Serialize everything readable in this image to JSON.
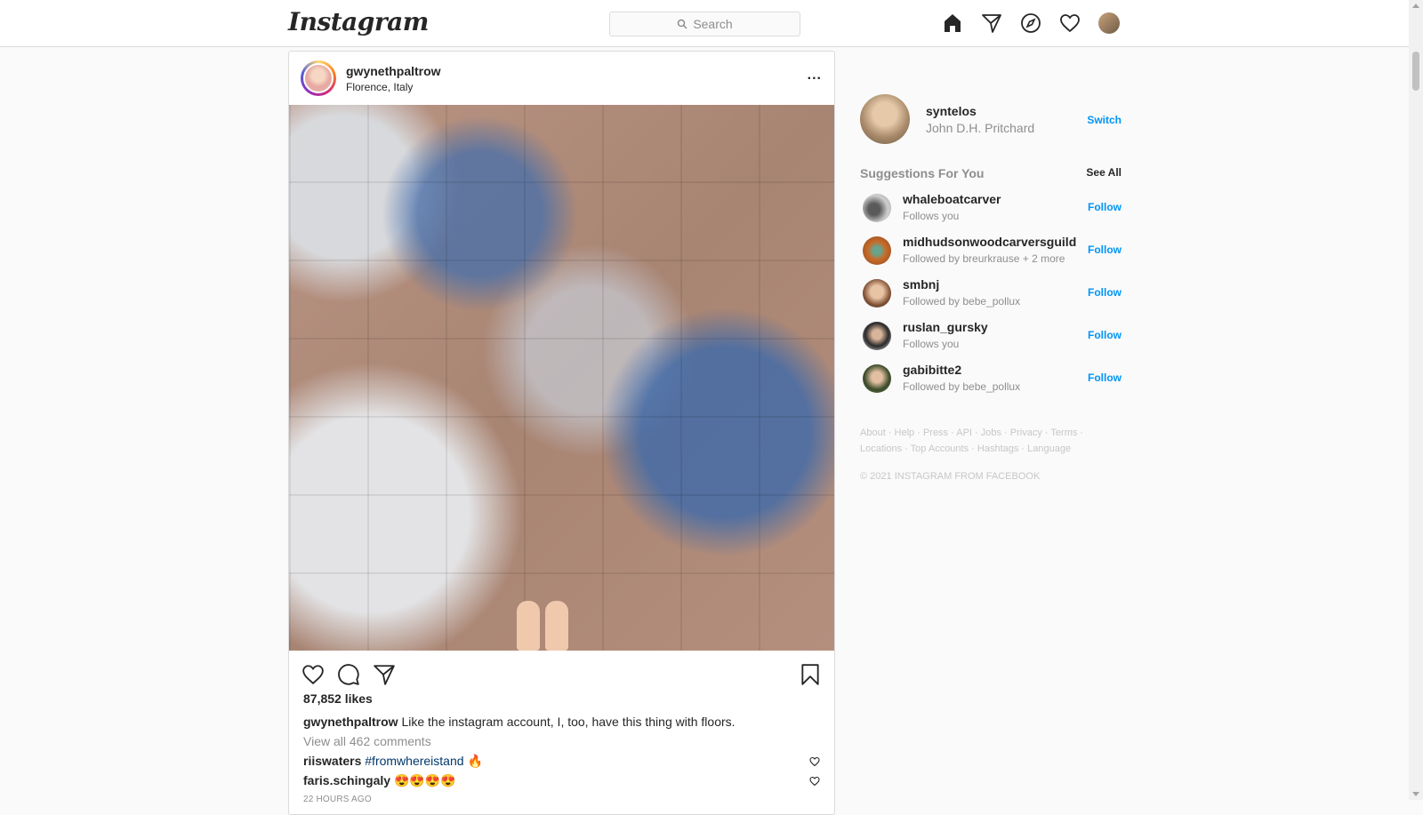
{
  "nav": {
    "logo": "Instagram",
    "search_placeholder": "Search",
    "icons": [
      "home-icon",
      "direct-icon",
      "explore-icon",
      "activity-icon",
      "profile-icon"
    ]
  },
  "post": {
    "username": "gwynethpaltrow",
    "location": "Florence, Italy",
    "more": "...",
    "likes": "87,852 likes",
    "caption_user": "gwynethpaltrow",
    "caption_text": "Like the instagram account, I, too, have this thing with floors.",
    "view_comments": "View all 462 comments",
    "comments": [
      {
        "user": "riiswaters",
        "hashtag": "#fromwhereistand",
        "text": "🔥"
      },
      {
        "user": "faris.schingaly",
        "hashtag": "",
        "text": "😍😍😍😍"
      }
    ],
    "time": "22 HOURS AGO"
  },
  "sidebar": {
    "me_username": "syntelos",
    "me_name": "John D.H. Pritchard",
    "switch": "Switch",
    "suggestions_title": "Suggestions For You",
    "see_all": "See All",
    "suggestions": [
      {
        "username": "whaleboatcarver",
        "sub": "Follows you",
        "follow": "Follow"
      },
      {
        "username": "midhudsonwoodcarversguild",
        "sub": "Followed by breurkrause + 2 more",
        "follow": "Follow"
      },
      {
        "username": "smbnj",
        "sub": "Followed by bebe_pollux",
        "follow": "Follow"
      },
      {
        "username": "ruslan_gursky",
        "sub": "Follows you",
        "follow": "Follow"
      },
      {
        "username": "gabibitte2",
        "sub": "Followed by bebe_pollux",
        "follow": "Follow"
      }
    ],
    "footer_line1": [
      "About",
      "Help",
      "Press",
      "API",
      "Jobs",
      "Privacy",
      "Terms"
    ],
    "footer_line2": [
      "Locations",
      "Top Accounts",
      "Hashtags",
      "Language"
    ],
    "copyright": "© 2021 INSTAGRAM FROM FACEBOOK"
  },
  "colors": {
    "link_blue": "#0095f6",
    "hashtag": "#00376b",
    "muted": "#8e8e8e",
    "border": "#dbdbdb"
  }
}
